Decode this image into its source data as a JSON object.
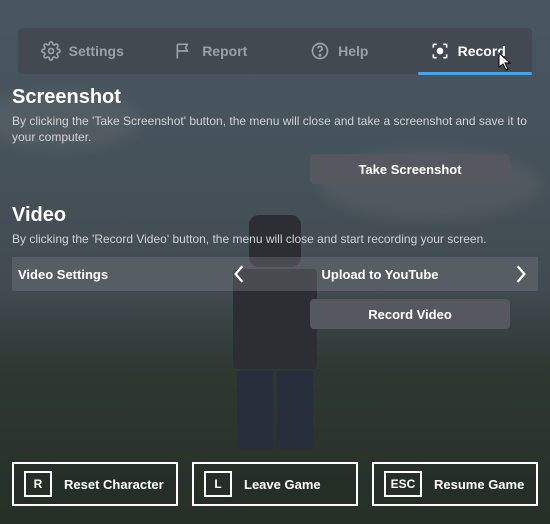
{
  "tabs": {
    "settings": "Settings",
    "report": "Report",
    "help": "Help",
    "record": "Record",
    "active_index": 3
  },
  "screenshot": {
    "heading": "Screenshot",
    "desc": "By clicking the 'Take Screenshot' button, the menu will close and take a screenshot and save it to your computer.",
    "button": "Take Screenshot"
  },
  "video": {
    "heading": "Video",
    "desc": "By clicking the 'Record Video' button, the menu will close and start recording your screen.",
    "settings_label": "Video Settings",
    "selected_option": "Upload to YouTube",
    "button": "Record Video"
  },
  "bottom": {
    "reset": {
      "key": "R",
      "label": "Reset Character"
    },
    "leave": {
      "key": "L",
      "label": "Leave Game"
    },
    "resume": {
      "key": "ESC",
      "label": "Resume Game"
    }
  },
  "colors": {
    "accent": "#33aaff"
  }
}
